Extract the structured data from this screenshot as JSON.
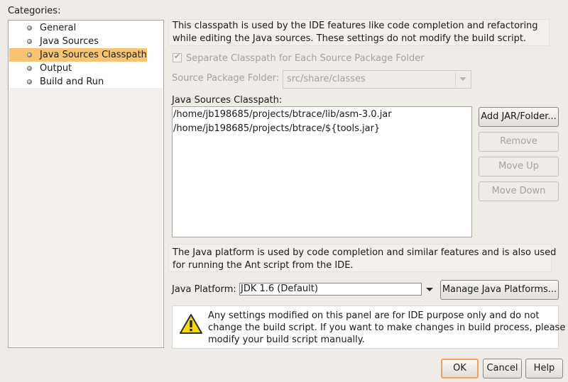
{
  "categories": {
    "title": "Categories:",
    "items": [
      {
        "label": "General"
      },
      {
        "label": "Java Sources"
      },
      {
        "label": "Java Sources Classpath",
        "selected": true
      },
      {
        "label": "Output"
      },
      {
        "label": "Build and Run"
      }
    ]
  },
  "panel": {
    "description_line1": "This classpath is used by the IDE features like code completion and refactoring",
    "description_line2": "while editing the Java sources. These settings do not modify the build script.",
    "separate_classpath_label": "Separate Classpath for Each Source Package Folder",
    "separate_classpath_checked": true,
    "source_package_folder_label": "Source Package Folder:",
    "source_package_folder_value": "src/share/classes",
    "java_sources_classpath_label": "Java Sources Classpath:",
    "classpath_entries": [
      "/home/jb198685/projects/btrace/lib/asm-3.0.jar",
      "/home/jb198685/projects/btrace/${tools.jar}"
    ],
    "buttons": {
      "add_jar": "Add JAR/Folder...",
      "remove": "Remove",
      "move_up": "Move Up",
      "move_down": "Move Down"
    },
    "platform_desc_line1": "The Java platform is used by code completion and similar features and is also used",
    "platform_desc_line2": "for running the Ant script from the IDE.",
    "java_platform_label": "Java Platform:",
    "java_platform_value": "JDK 1.6 (Default)",
    "manage_platforms": "Manage Java Platforms...",
    "warning_line1": "Any settings modified on this panel are for IDE purpose only and do not",
    "warning_line2": "change the build script. If you want to make changes in build process, please",
    "warning_line3": "modify your build script manually."
  },
  "dialog_buttons": {
    "ok": "OK",
    "cancel": "Cancel",
    "help": "Help"
  },
  "colors": {
    "selection": "#f9c471",
    "background": "#efebe7",
    "default_button_border": "#e9a260"
  }
}
